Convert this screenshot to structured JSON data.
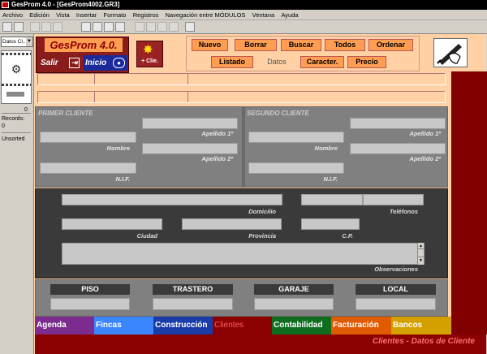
{
  "window": {
    "title": "GesProm 4.0 - [GesProm4002.GR3]"
  },
  "menu": [
    "Archivo",
    "Edición",
    "Vista",
    "Insertar",
    "Formato",
    "Registros",
    "Navegación entre MÓDULOS",
    "Ventana",
    "Ayuda"
  ],
  "left_panel": {
    "selector": "Datos Cl...",
    "counter": "0",
    "records_label": "Records:",
    "records_value": "0",
    "sort_label": "Unsorted"
  },
  "logo": {
    "title": "GesProm 4.0.",
    "salir": "Salir",
    "inicio": "Inicio"
  },
  "new_client": {
    "label": "+ Clie."
  },
  "buttons": {
    "nuevo": "Nuevo",
    "borrar": "Borrar",
    "buscar": "Buscar",
    "todos": "Todos",
    "ordenar": "Ordenar",
    "listado": "Listado",
    "datos": "Datos",
    "caracter": "Caracter.",
    "precio": "Precio"
  },
  "primer_cliente": {
    "title": "PRIMER CLIENTE",
    "nombre": "Nombre",
    "apellido1": "Apellido 1º",
    "apellido2": "Apellido 2º",
    "nif": "N.I.F."
  },
  "segundo_cliente": {
    "title": "SEGUNDO CLIENTE",
    "nombre": "Nombre",
    "apellido1": "Apellido 1º",
    "apellido2": "Apellido 2º",
    "nif": "N.I.F."
  },
  "address": {
    "domicilio": "Domicilio",
    "telefonos": "Teléfonos",
    "ciudad": "Ciudad",
    "provincia": "Provincia",
    "cp": "C.P.",
    "observaciones": "Observaciones"
  },
  "property_types": [
    "PISO",
    "TRASTERO",
    "GARAJE",
    "LOCAL"
  ],
  "module_tabs": [
    {
      "label": "Agenda",
      "color": "#7b2c8e"
    },
    {
      "label": "Fincas",
      "color": "#3a86ff"
    },
    {
      "label": "Construcción",
      "color": "#1a3ca8"
    },
    {
      "label": "Clientes",
      "color": "#8b0000"
    },
    {
      "label": "Contabilidad",
      "color": "#0e6e1e"
    },
    {
      "label": "Facturación",
      "color": "#e05a00"
    },
    {
      "label": "Bancos",
      "color": "#d4a000"
    }
  ],
  "status": {
    "text": "Clientes - Datos de Cliente"
  },
  "icons": [
    "save-icon",
    "print-icon",
    "cut-icon",
    "copy-icon",
    "paste-icon",
    "help-icon",
    "film-reel-icon",
    "exit-door-icon",
    "home-icon",
    "star-icon",
    "hand-pen-icon"
  ]
}
